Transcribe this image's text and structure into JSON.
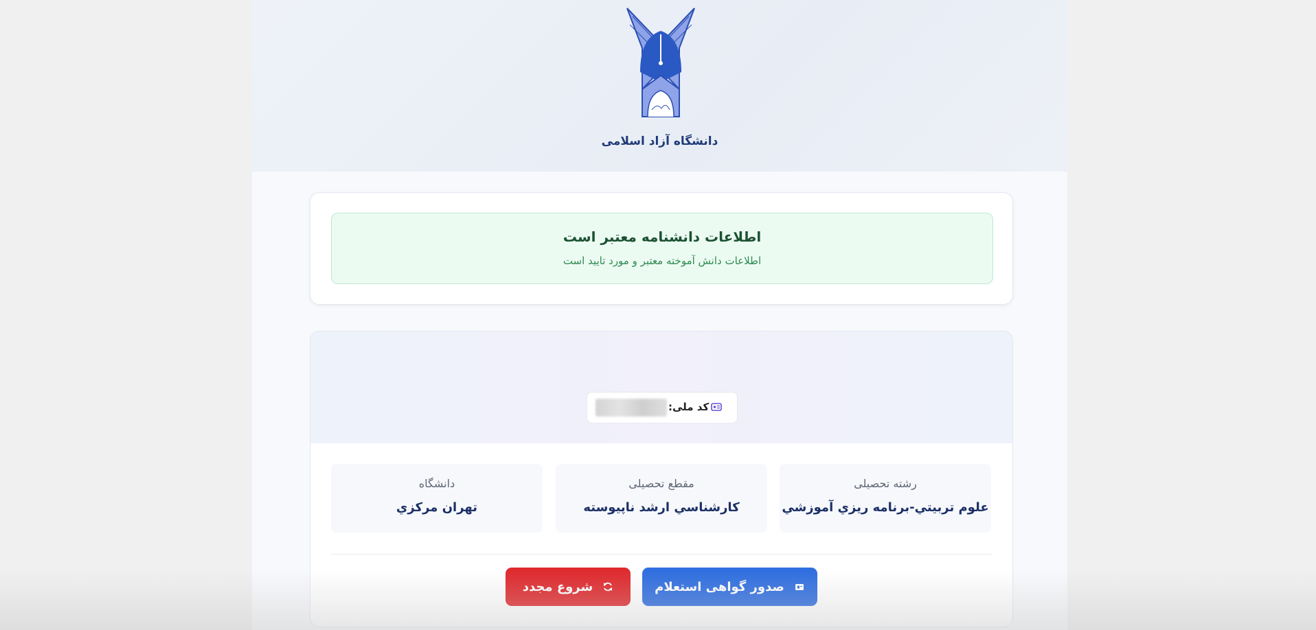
{
  "header": {
    "university_name": "دانشگاه آزاد اسلامی",
    "logo_icon": "azad-university-logo"
  },
  "status": {
    "title": "اطلاعات دانشنامه معتبر است",
    "subtitle": "اطلاعات دانش آموخته معتبر و مورد تایید است",
    "color": "#2f8a52"
  },
  "student": {
    "national_id_label": "کد ملی:",
    "national_id_value": "",
    "national_id_icon": "id-card-icon"
  },
  "details": [
    {
      "label": "رشته تحصیلی",
      "value": "علوم تربيتي-برنامه ريزي آموزشي"
    },
    {
      "label": "مقطع تحصیلی",
      "value": "کارشناسي ارشد ناپيوسته"
    },
    {
      "label": "دانشگاه",
      "value": "تهران مرکزي"
    }
  ],
  "actions": {
    "issue_certificate": "صدور گواهی استعلام",
    "issue_icon": "certificate-icon",
    "restart": "شروع مجدد",
    "restart_icon": "refresh-icon",
    "primary_color": "#2f6ee0",
    "danger_color": "#df2a2e"
  }
}
